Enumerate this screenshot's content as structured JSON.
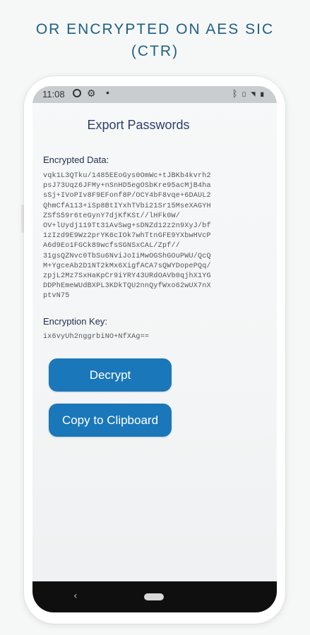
{
  "caption": {
    "line1": "OR ENCRYPTED ON AES SIC",
    "line2": "(CTR)"
  },
  "status_bar": {
    "time": "11:08",
    "left_icons": [
      "google-icon",
      "gear-icon",
      "dot-icon"
    ],
    "right_icons": [
      "bluetooth-icon",
      "vibrate-icon",
      "wifi-icon",
      "battery-icon"
    ]
  },
  "screen": {
    "title": "Export Passwords",
    "encrypted_label": "Encrypted Data:",
    "encrypted_lines": [
      "vqk1L3QTku/1485EEoGys0OmWc+tJBKb4kvrh2",
      "psJ73Uqz6JFMy+nSnHD5egOSbKre95acMjB4ha",
      "sSj+IVoPIv8F9EFonf8P/OCY4bF8vqe+6DAUL2",
      "QhmCfA113+iSp8BtIYxhTVbi21Sr15MseXAGYH",
      "ZSfS59r6teGynY7djKfKSt//lHFk0W/",
      "OV+lUydj119Tt31AvSwg+sDNZd12z2n9XyJ/bf",
      "1zIzd9E9Wz2prYK6cIOk7whTtnGFE9YXbwHVcP",
      "A6d9Eo1FGCk89wcfsSGNSxCAL/Zpf//",
      "31gsQZNvc0TbSu6NviJoIiMwOGShGOuPWU/QcQ",
      "M+YgceAb2D1NT2kMx6XigfACA7sQWYDopePQq/",
      "zpjL2Mz7SxHaKpCr9iYRY43URdOAVb0qjhX1YG",
      "DDPhEmeWUdBXPL3KDkTQU2nnQyfWxo62wUX7nX",
      "ptvN75"
    ],
    "key_label": "Encryption Key:",
    "key_value": "ix6vyUh2nggrbiNO+NfXAg==",
    "decrypt_label": "Decrypt",
    "copy_label": "Copy to Clipboard"
  },
  "nav_bar": {
    "back_icon": "back-chevron-icon",
    "home_icon": "home-pill-icon"
  },
  "colors": {
    "caption": "#1f5f86",
    "button": "#1a77b9",
    "status_bar": "#c9cdd0",
    "nav_bar": "#0f0f0f"
  }
}
